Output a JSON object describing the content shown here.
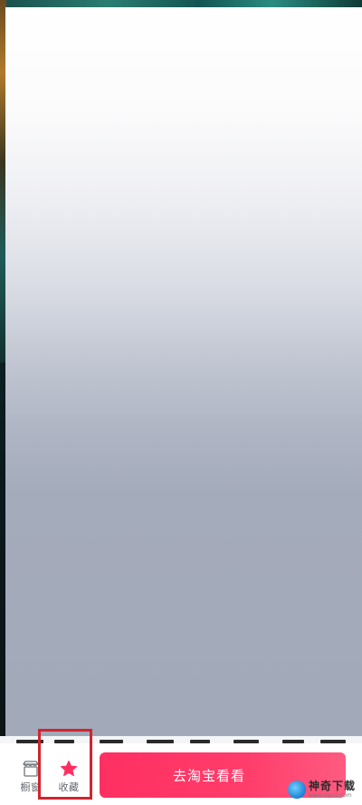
{
  "bottom_bar": {
    "tabs": [
      {
        "label": "橱窗",
        "icon": "storefront-icon"
      },
      {
        "label": "收藏",
        "icon": "star-icon"
      }
    ],
    "cta_label": "去淘宝看看"
  },
  "colors": {
    "accent": "#ff3d6b",
    "star": "#ff2f62",
    "highlight_border": "#d1242f"
  },
  "watermark": {
    "title": "神奇下载",
    "url": "www.sqxzz.com"
  }
}
